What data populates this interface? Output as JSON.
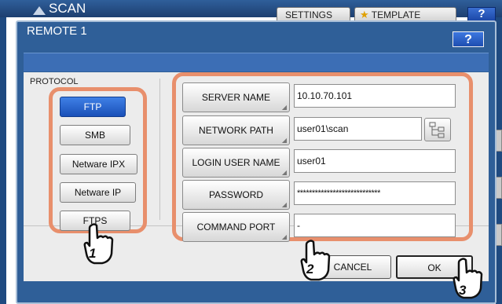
{
  "app": {
    "title": "SCAN",
    "header_buttons": {
      "settings": "SETTINGS",
      "template": "TEMPLATE",
      "help": "?"
    }
  },
  "dialog": {
    "title": "REMOTE 1",
    "help": "?"
  },
  "protocol": {
    "label": "PROTOCOL",
    "options": [
      "FTP",
      "SMB",
      "Netware IPX",
      "Netware IP",
      "FTPS"
    ],
    "selected": "FTP"
  },
  "fields": {
    "server_name": {
      "label": "SERVER NAME",
      "value": "10.10.70.101"
    },
    "network_path": {
      "label": "NETWORK PATH",
      "value": "user01\\scan"
    },
    "login_user_name": {
      "label": "LOGIN USER NAME",
      "value": "user01"
    },
    "password": {
      "label": "PASSWORD",
      "value": "****************************"
    },
    "command_port": {
      "label": "COMMAND PORT",
      "value": "-"
    }
  },
  "actions": {
    "cancel": "CANCEL",
    "ok": "OK"
  },
  "callouts": [
    "1",
    "2",
    "3"
  ],
  "colors": {
    "highlight": "#e88f6c",
    "selected": "#2a62cf",
    "frame": "#2f5f98"
  }
}
